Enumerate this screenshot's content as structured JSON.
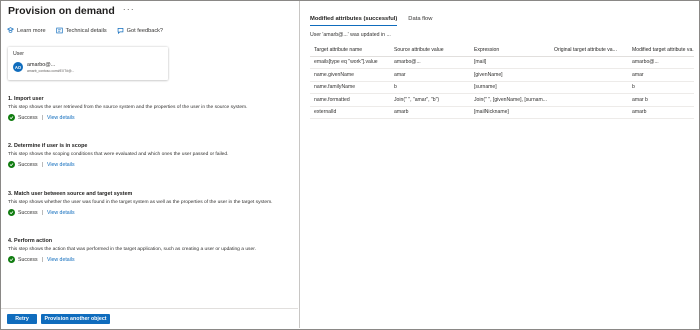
{
  "header": {
    "title": "Provision on demand",
    "more": "···"
  },
  "commands": {
    "learn_more": "Learn more",
    "technical_details": "Technical details",
    "got_feedback": "Got feedback?"
  },
  "user_card": {
    "label": "User",
    "name": "amarbo@...",
    "subtitle": "amarb_contoso.com#EXT#@...",
    "avatar_initials": "AO"
  },
  "steps": [
    {
      "title": "1. Import user",
      "description": "This step shows the user retrieved from the source system and the properties of the user in the source system.",
      "status": "Success",
      "link": "View details"
    },
    {
      "title": "2. Determine if user is in scope",
      "description": "This step shows the scoping conditions that were evaluated and which ones the user passed or failed.",
      "status": "Success",
      "link": "View details"
    },
    {
      "title": "3. Match user between source and target system",
      "description": "This step shows whether the user was found in the target system as well as the properties of the user in the target system.",
      "status": "Success",
      "link": "View details"
    },
    {
      "title": "4. Perform action",
      "description": "This step shows the action that was performed in the target application, such as creating a user or updating a user.",
      "status": "Success",
      "link": "View details"
    }
  ],
  "footer": {
    "retry": "Retry",
    "provision_another": "Provision another object"
  },
  "right_panel": {
    "tabs": [
      "Modified attributes (successful)",
      "Data flow"
    ],
    "update_message": "User 'amarb@...' was updated in ...",
    "columns": [
      "Target attribute name",
      "Source attribute value",
      "Expression",
      "Original target attribute va...",
      "Modified target attribute va..."
    ],
    "rows": [
      [
        "emails[type eq \"work\"].value",
        "amarbo@...",
        "[mail]",
        "",
        "amarbo@..."
      ],
      [
        "name.givenName",
        "amar",
        "[givenName]",
        "",
        "amar"
      ],
      [
        "name.familyName",
        "b",
        "[surname]",
        "",
        "b"
      ],
      [
        "name.formatted",
        "Join(\" \", \"amar\", \"b\")",
        "Join(\" \", [givenName], [surnam...",
        "",
        "amar b"
      ],
      [
        "externalId",
        "amarb",
        "[mailNickname]",
        "",
        "amarb"
      ]
    ]
  },
  "colors": {
    "accent": "#0f6cbd",
    "success": "#107c10"
  }
}
